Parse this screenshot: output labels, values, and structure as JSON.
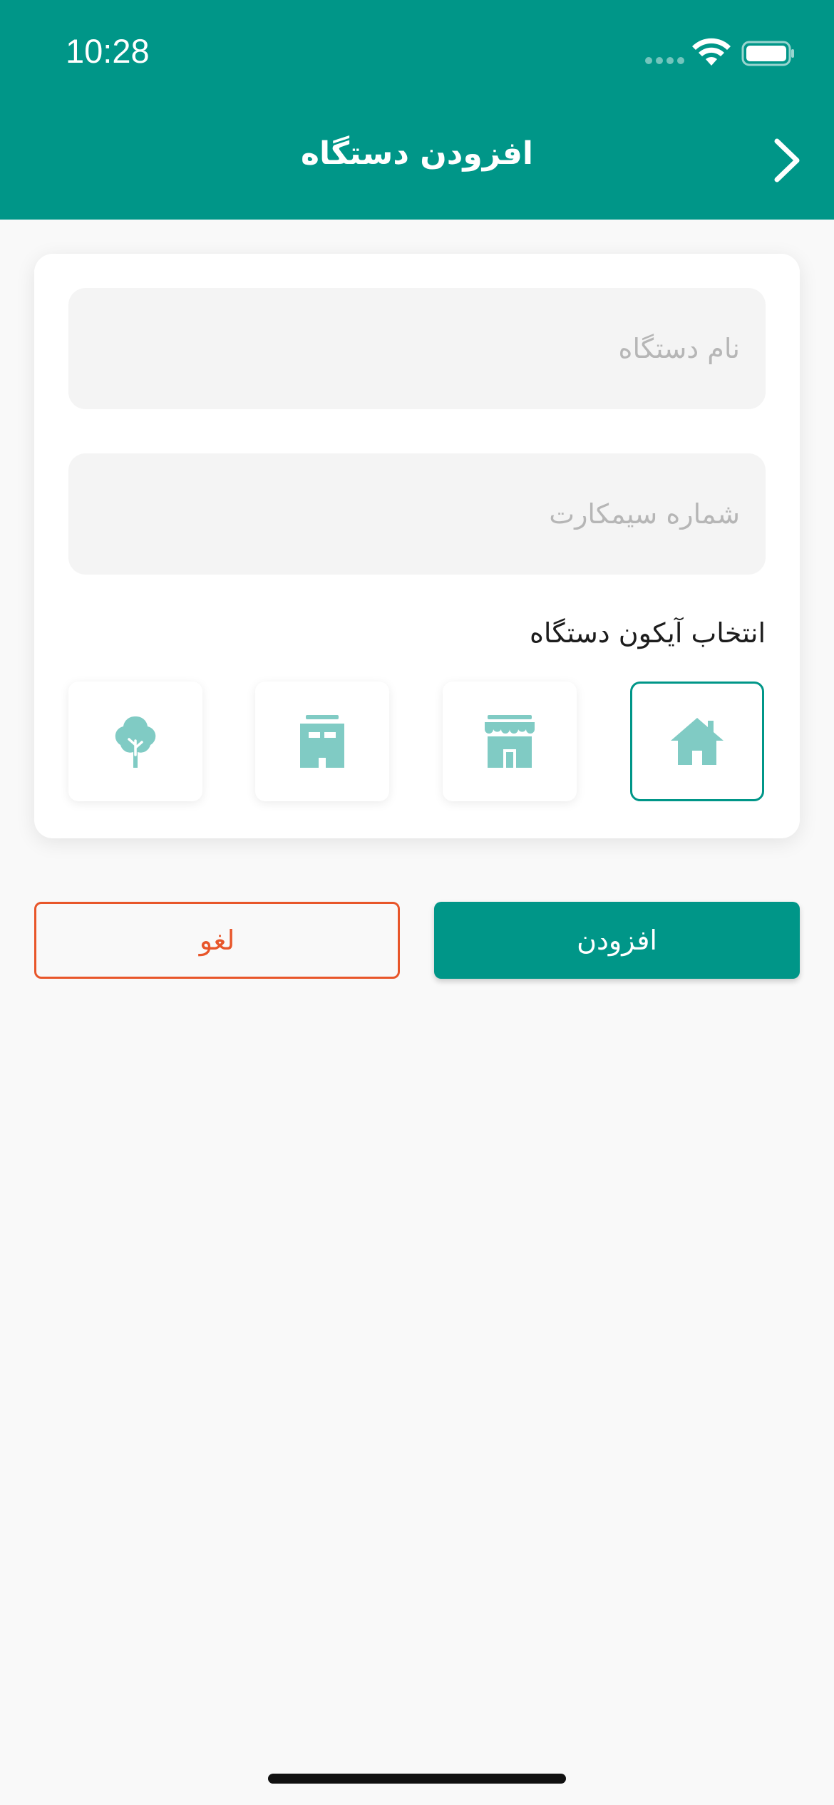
{
  "status_bar": {
    "time": "10:28"
  },
  "header": {
    "title": "افزودن دستگاه",
    "back_icon": "chevron-right-icon"
  },
  "form": {
    "device_name": {
      "value": "",
      "placeholder": "نام دستگاه"
    },
    "sim_number": {
      "value": "",
      "placeholder": "شماره سیمکارت"
    },
    "icon_section_label": "انتخاب آیکون دستگاه",
    "icons": [
      {
        "name": "home-icon",
        "selected": true
      },
      {
        "name": "store-icon",
        "selected": false
      },
      {
        "name": "building-icon",
        "selected": false
      },
      {
        "name": "tree-icon",
        "selected": false
      }
    ]
  },
  "actions": {
    "add_label": "افزودن",
    "cancel_label": "لغو"
  },
  "colors": {
    "primary": "#009688",
    "icon_fill": "#80cbc4",
    "cancel": "#e8562a",
    "background": "#f9f9f9"
  }
}
